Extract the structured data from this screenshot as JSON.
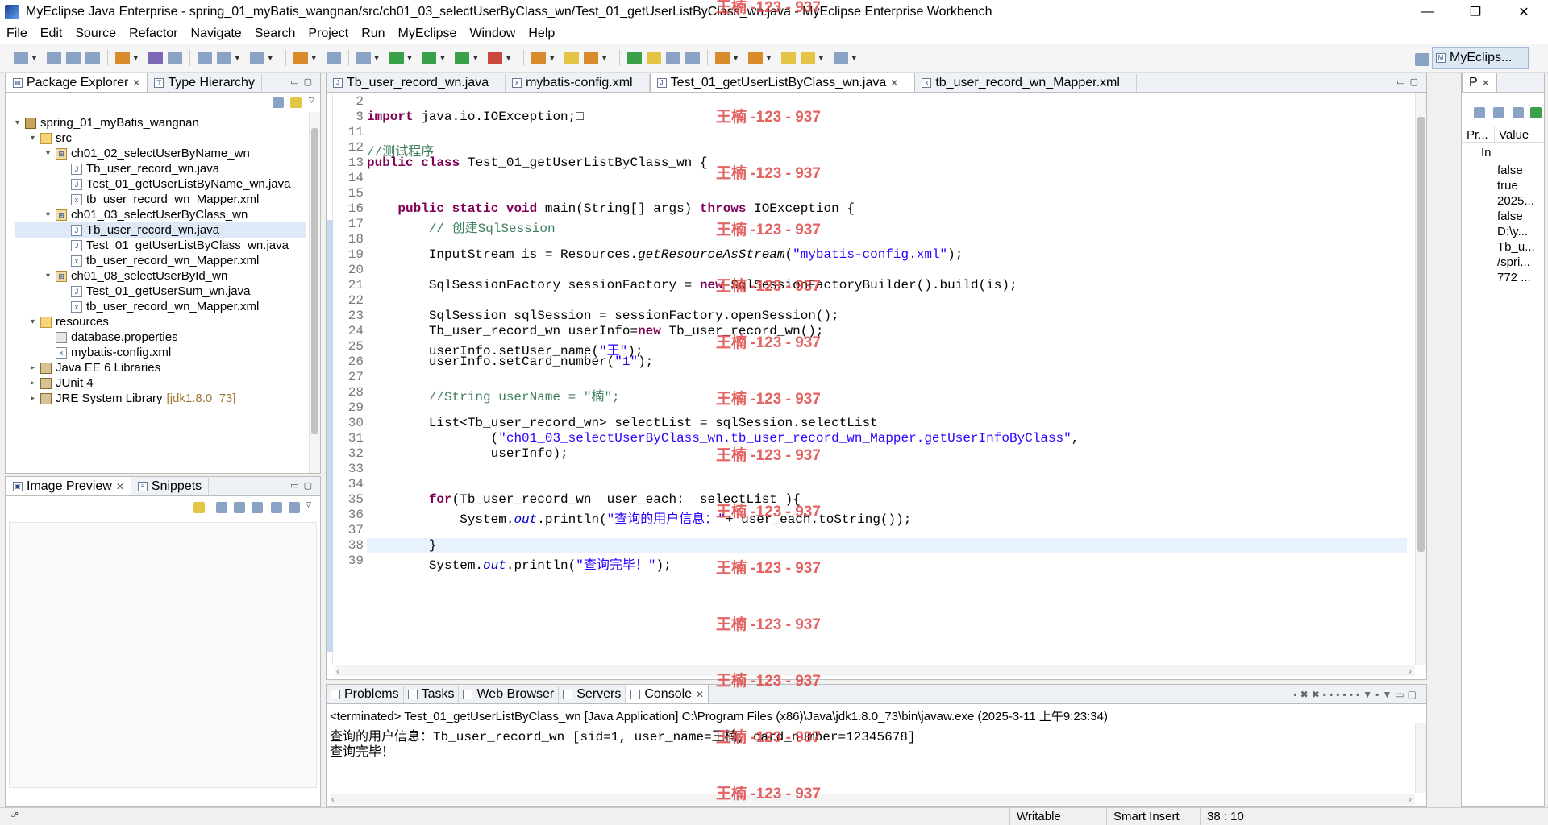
{
  "window": {
    "title": "MyEclipse Java Enterprise - spring_01_myBatis_wangnan/src/ch01_03_selectUserByClass_wn/Test_01_getUserListByClass_wn.java - MyEclipse Enterprise Workbench",
    "minimize": "—",
    "restore": "❐",
    "close": "✕"
  },
  "menu": [
    "File",
    "Edit",
    "Source",
    "Refactor",
    "Navigate",
    "Search",
    "Project",
    "Run",
    "MyEclipse",
    "Window",
    "Help"
  ],
  "perspective": {
    "label": "MyEclips..."
  },
  "package_explorer": {
    "tabs": [
      {
        "label": "Package Explorer",
        "close": "✕"
      },
      {
        "label": "Type Hierarchy"
      }
    ],
    "tree": [
      {
        "label": "spring_01_myBatis_wangnan",
        "type": "prj",
        "level": 0,
        "expander": "▾"
      },
      {
        "label": "src",
        "type": "folder",
        "level": 1,
        "expander": "▾"
      },
      {
        "label": "ch01_02_selectUserByName_wn",
        "type": "pkg",
        "level": 2,
        "expander": "▾"
      },
      {
        "label": "Tb_user_record_wn.java",
        "type": "java",
        "level": 3
      },
      {
        "label": "Test_01_getUserListByName_wn.java",
        "type": "java",
        "level": 3
      },
      {
        "label": "tb_user_record_wn_Mapper.xml",
        "type": "xml",
        "level": 3
      },
      {
        "label": "ch01_03_selectUserByClass_wn",
        "type": "pkg",
        "level": 2,
        "expander": "▾"
      },
      {
        "label": "Tb_user_record_wn.java",
        "type": "java",
        "level": 3,
        "selected": true
      },
      {
        "label": "Test_01_getUserListByClass_wn.java",
        "type": "java",
        "level": 3
      },
      {
        "label": "tb_user_record_wn_Mapper.xml",
        "type": "xml",
        "level": 3
      },
      {
        "label": "ch01_08_selectUserById_wn",
        "type": "pkg",
        "level": 2,
        "expander": "▾"
      },
      {
        "label": "Test_01_getUserSum_wn.java",
        "type": "java",
        "level": 3
      },
      {
        "label": "tb_user_record_wn_Mapper.xml",
        "type": "xml",
        "level": 3
      },
      {
        "label": "resources",
        "type": "folder",
        "level": 1,
        "expander": "▾"
      },
      {
        "label": "database.properties",
        "type": "props",
        "level": 2
      },
      {
        "label": "mybatis-config.xml",
        "type": "xml",
        "level": 2
      },
      {
        "label": "Java EE 6 Libraries",
        "type": "lib",
        "level": 1,
        "expander": "▸"
      },
      {
        "label": "JUnit 4",
        "type": "lib",
        "level": 1,
        "expander": "▸"
      },
      {
        "label": "JRE System Library",
        "suffix": "[jdk1.8.0_73]",
        "type": "lib",
        "level": 1,
        "expander": "▸"
      }
    ]
  },
  "image_preview": {
    "tabs": [
      {
        "label": "Image Preview",
        "close": "✕"
      },
      {
        "label": "Snippets"
      }
    ]
  },
  "editor": {
    "tabs": [
      {
        "label": "Tb_user_record_wn.java",
        "active": false
      },
      {
        "label": "mybatis-config.xml",
        "active": false
      },
      {
        "label": "Test_01_getUserListByClass_wn.java",
        "active": true,
        "close": "✕"
      },
      {
        "label": "tb_user_record_wn_Mapper.xml",
        "active": false
      }
    ],
    "lines": [
      {
        "n": "2",
        "html": ""
      },
      {
        "n": "3",
        "fold": "+",
        "html": "<span class='kw'>import</span> java.io.IOException;&#9633;"
      },
      {
        "n": "11",
        "html": ""
      },
      {
        "n": "12",
        "html": "<span class='cm'>//测试程序</span>"
      },
      {
        "n": "13",
        "html": "<span class='kw'>public</span> <span class='kw'>class</span> Test_01_getUserListByClass_wn {"
      },
      {
        "n": "14",
        "html": ""
      },
      {
        "n": "15",
        "html": ""
      },
      {
        "n": "16",
        "fold": "-",
        "html": "    <span class='kw'>public</span> <span class='kw'>static</span> <span class='kw'>void</span> main(String[] args) <span class='kw'>throws</span> IOException {"
      },
      {
        "n": "17",
        "html": "        <span class='cm'>// 创建SqlSession</span>"
      },
      {
        "n": "18",
        "html": ""
      },
      {
        "n": "19",
        "html": "        InputStream is = Resources.<span class='it'>getResourceAsStream</span>(<span class='str'>\"mybatis-config.xml\"</span>);"
      },
      {
        "n": "20",
        "html": ""
      },
      {
        "n": "21",
        "html": "        SqlSessionFactory sessionFactory = <span class='kw'>new</span> SqlSessionFactoryBuilder().build(is);"
      },
      {
        "n": "22",
        "html": ""
      },
      {
        "n": "23",
        "html": "        SqlSession sqlSession = sessionFactory.openSession();"
      },
      {
        "n": "24",
        "html": "        Tb_user_record_wn userInfo=<span class='kw'>new</span> Tb_user_record_wn();"
      },
      {
        "n": "25",
        "html": "        userInfo.setUser_name(<span class='str'>\"王\"</span>);"
      },
      {
        "n": "26",
        "html": "        userInfo.setCard_number(<span class='str'>\"1\"</span>);"
      },
      {
        "n": "27",
        "html": ""
      },
      {
        "n": "28",
        "html": "        <span class='cm'>//String userName = \"楠\";</span>"
      },
      {
        "n": "29",
        "html": ""
      },
      {
        "n": "30",
        "html": "        List&lt;Tb_user_record_wn&gt; selectList = sqlSession.selectList"
      },
      {
        "n": "31",
        "html": "                (<span class='str'>\"ch01_03_selectUserByClass_wn.tb_user_record_wn_Mapper.getUserInfoByClass\"</span>,"
      },
      {
        "n": "32",
        "html": "                userInfo);"
      },
      {
        "n": "33",
        "html": ""
      },
      {
        "n": "34",
        "html": ""
      },
      {
        "n": "35",
        "html": "        <span class='kw'>for</span>(Tb_user_record_wn  user_each:  selectList ){"
      },
      {
        "n": "36",
        "html": "            System.<span class='fld'>out</span>.println(<span class='str'>\"查询的用户信息：\"</span>+ user_each.toString());"
      },
      {
        "n": "37",
        "html": ""
      },
      {
        "n": "38",
        "html": "        }",
        "current": true
      },
      {
        "n": "39",
        "html": "        System.<span class='fld'>out</span>.println(<span class='str'>\"查询完毕！\"</span>);"
      }
    ]
  },
  "properties": {
    "tab": "P",
    "col_property": "Pr...",
    "col_value": "Value",
    "group": "In",
    "values": [
      "false",
      "true",
      "2025...",
      "false",
      "D:\\y...",
      "Tb_u...",
      "/spri...",
      "772 ..."
    ]
  },
  "console": {
    "tabs": [
      {
        "label": "Problems"
      },
      {
        "label": "Tasks"
      },
      {
        "label": "Web Browser"
      },
      {
        "label": "Servers"
      },
      {
        "label": "Console",
        "active": true,
        "close": "✕"
      }
    ],
    "header": "<terminated> Test_01_getUserListByClass_wn [Java Application] C:\\Program Files (x86)\\Java\\jdk1.8.0_73\\bin\\javaw.exe (2025-3-11 上午9:23:34)",
    "output": [
      "查询的用户信息：Tb_user_record_wn [sid=1, user_name=王楠, card_number=12345678]",
      "查询完毕！"
    ]
  },
  "watermark": "王楠 -123 - 937",
  "status": {
    "writable": "Writable",
    "insert": "Smart Insert",
    "position": "38 : 10"
  }
}
